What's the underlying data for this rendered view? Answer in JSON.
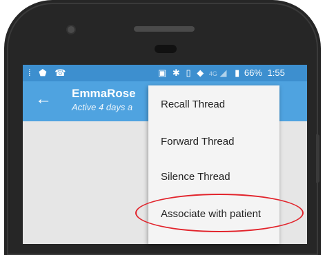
{
  "status": {
    "left_icons": [
      "notification-icon",
      "android-icon",
      "missed-call-icon"
    ],
    "right_icons": [
      "cast-icon",
      "bluetooth-icon",
      "vibrate-icon",
      "wifi-icon",
      "signal-icon",
      "battery-icon"
    ],
    "network": "4G",
    "battery": "66%",
    "time": "1:55"
  },
  "header": {
    "title": "EmmaRose",
    "subtitle": "Active 4 days a"
  },
  "menu": {
    "items": [
      "Recall Thread",
      "Forward Thread",
      "Silence Thread",
      "Associate with patient"
    ]
  },
  "colors": {
    "status_bar": "#3d8fcf",
    "app_bar": "#4fa3e0",
    "highlight": "#e2242c"
  }
}
